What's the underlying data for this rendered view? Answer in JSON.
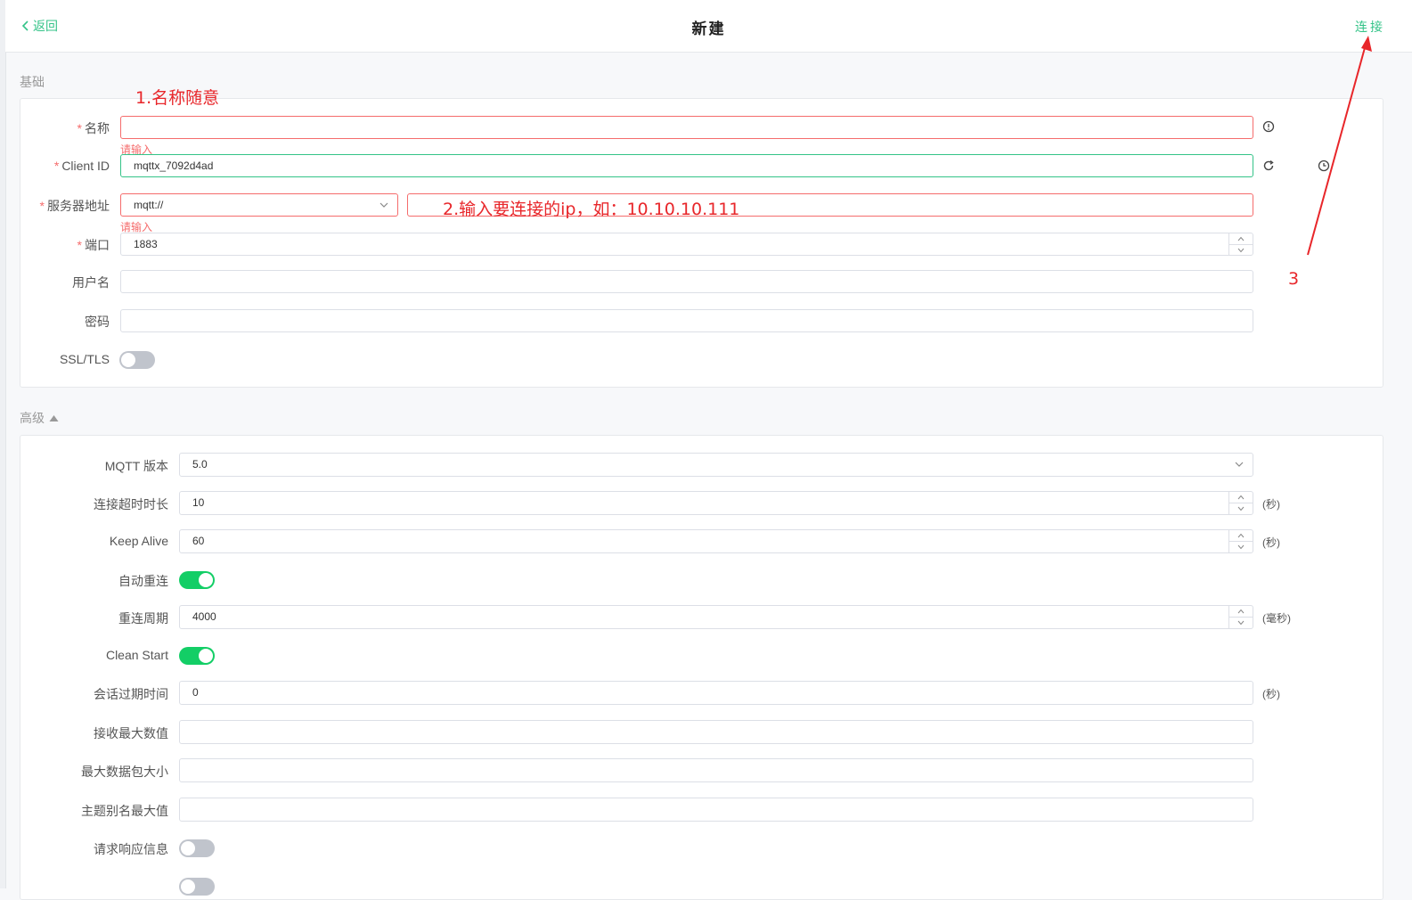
{
  "header": {
    "back_label": "返回",
    "title": "新建",
    "connect_label": "连接"
  },
  "basic": {
    "section_title": "基础",
    "name": {
      "label": "名称",
      "value": "",
      "error": "请输入"
    },
    "client_id": {
      "label": "Client ID",
      "value": "mqttx_7092d4ad"
    },
    "server": {
      "label": "服务器地址",
      "protocol": "mqtt://",
      "host": "",
      "error": "请输入"
    },
    "port": {
      "label": "端口",
      "value": "1883"
    },
    "username": {
      "label": "用户名",
      "value": ""
    },
    "password": {
      "label": "密码",
      "value": ""
    },
    "ssl": {
      "label": "SSL/TLS",
      "enabled": false
    }
  },
  "advanced": {
    "section_title": "高级",
    "mqtt_version": {
      "label": "MQTT 版本",
      "value": "5.0"
    },
    "connect_timeout": {
      "label": "连接超时时长",
      "value": "10",
      "unit": "(秒)"
    },
    "keep_alive": {
      "label": "Keep Alive",
      "value": "60",
      "unit": "(秒)"
    },
    "auto_reconnect": {
      "label": "自动重连",
      "enabled": true
    },
    "reconnect_period": {
      "label": "重连周期",
      "value": "4000",
      "unit": "(毫秒)"
    },
    "clean_start": {
      "label": "Clean Start",
      "enabled": true
    },
    "session_expiry": {
      "label": "会话过期时间",
      "value": "0",
      "unit": "(秒)"
    },
    "receive_maximum": {
      "label": "接收最大数值",
      "value": ""
    },
    "max_packet_size": {
      "label": "最大数据包大小",
      "value": ""
    },
    "topic_alias_maximum": {
      "label": "主题别名最大值",
      "value": ""
    },
    "request_response_info": {
      "label": "请求响应信息",
      "enabled": false
    }
  },
  "annotations": {
    "step1": "1.名称随意",
    "step2": "2.输入要连接的ip，如：10.10.10.111",
    "step3": "3"
  },
  "colors": {
    "accent": "#34c388",
    "error": "#f56c6c",
    "toggle_on": "#13ce66",
    "annotation": "#e8262a"
  }
}
